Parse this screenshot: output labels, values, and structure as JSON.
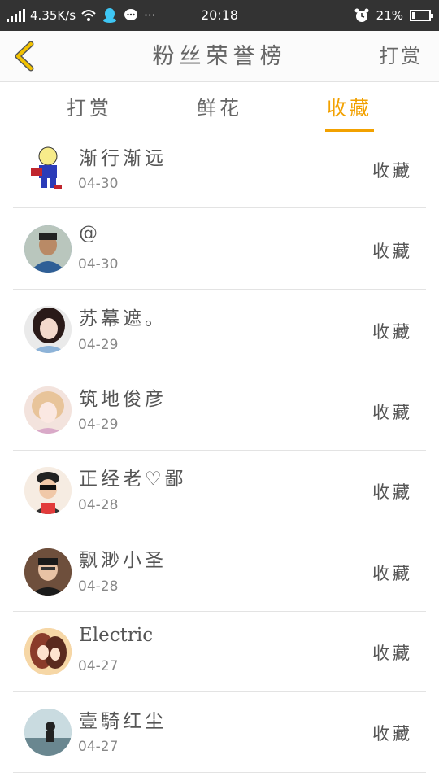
{
  "status_bar": {
    "network_speed": "4.35K/s",
    "time": "20:18",
    "battery": "21%",
    "battery_level": 0.21,
    "icons": [
      "signal-icon",
      "wifi-icon",
      "qq-icon",
      "chat-bubble-icon",
      "more-dots-icon",
      "alarm-icon",
      "battery-icon"
    ],
    "more": "···"
  },
  "header": {
    "title": "粉丝荣誉榜",
    "action": "打赏",
    "back_icon": "chevron-left-icon",
    "back_color": "#f2c200"
  },
  "tabs": [
    {
      "label": "打赏",
      "active": false
    },
    {
      "label": "鲜花",
      "active": false
    },
    {
      "label": "收藏",
      "active": true
    }
  ],
  "accent_color": "#f2a100",
  "list": [
    {
      "name": "渐行渐远",
      "date": "04-30",
      "action": "收藏"
    },
    {
      "name": "@",
      "date": "04-30",
      "action": "收藏"
    },
    {
      "name": "苏幕遮。",
      "date": "04-29",
      "action": "收藏"
    },
    {
      "name": "筑地俊彦",
      "date": "04-29",
      "action": "收藏"
    },
    {
      "name": "正经老♡鄙",
      "date": "04-28",
      "action": "收藏"
    },
    {
      "name": "飘渺小圣",
      "date": "04-28",
      "action": "收藏"
    },
    {
      "name": "Electric",
      "date": "04-27",
      "action": "收藏"
    },
    {
      "name": "壹騎红尘",
      "date": "04-27",
      "action": "收藏"
    }
  ]
}
